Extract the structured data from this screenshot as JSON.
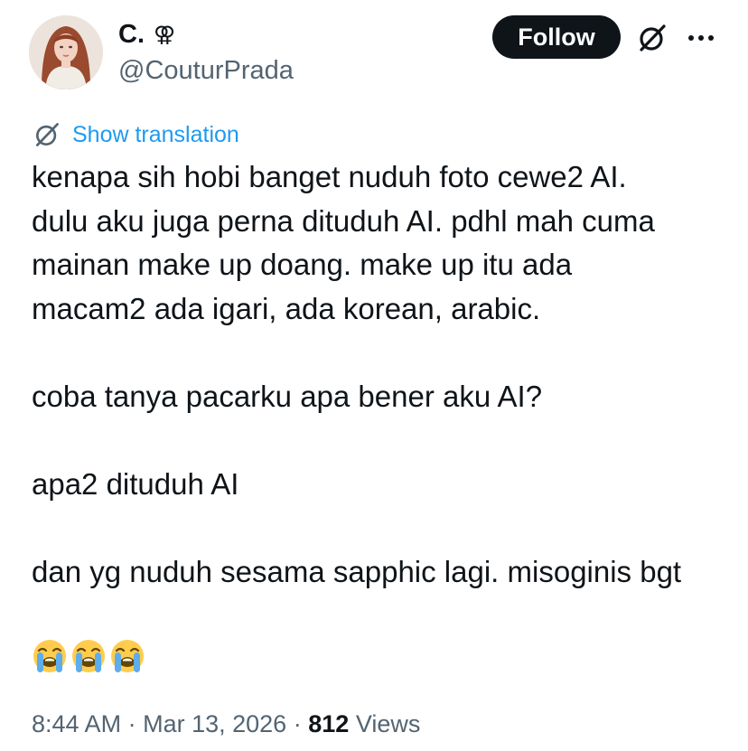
{
  "author": {
    "display_name": "C.",
    "badge": "⚢",
    "handle": "@CouturPrada"
  },
  "actions": {
    "follow_label": "Follow"
  },
  "icons": {
    "grok": "grok-icon",
    "more": "more-icon",
    "translation": "grok-translate-icon",
    "emoji": "loudly-crying-face-icon"
  },
  "translation": {
    "label": "Show translation"
  },
  "tweet": {
    "paragraphs": [
      "kenapa sih hobi banget nuduh foto cewe2 AI.\ndulu aku juga perna dituduh AI. pdhl mah cuma\nmainan make up doang. make up itu ada\nmacam2 ada igari, ada korean, arabic.",
      "coba tanya pacarku apa bener aku AI?",
      "apa2 dituduh AI",
      "dan yg nuduh sesama sapphic lagi. misoginis bgt"
    ],
    "emoji_count": 3
  },
  "meta": {
    "time": "8:44 AM",
    "separator": "·",
    "date": "Mar 13, 2026",
    "views_count": "812",
    "views_label": "Views"
  },
  "colors": {
    "text": "#0f1419",
    "secondary": "#536471",
    "link": "#1d9bf0",
    "button_bg": "#0f1419",
    "button_text": "#ffffff"
  }
}
